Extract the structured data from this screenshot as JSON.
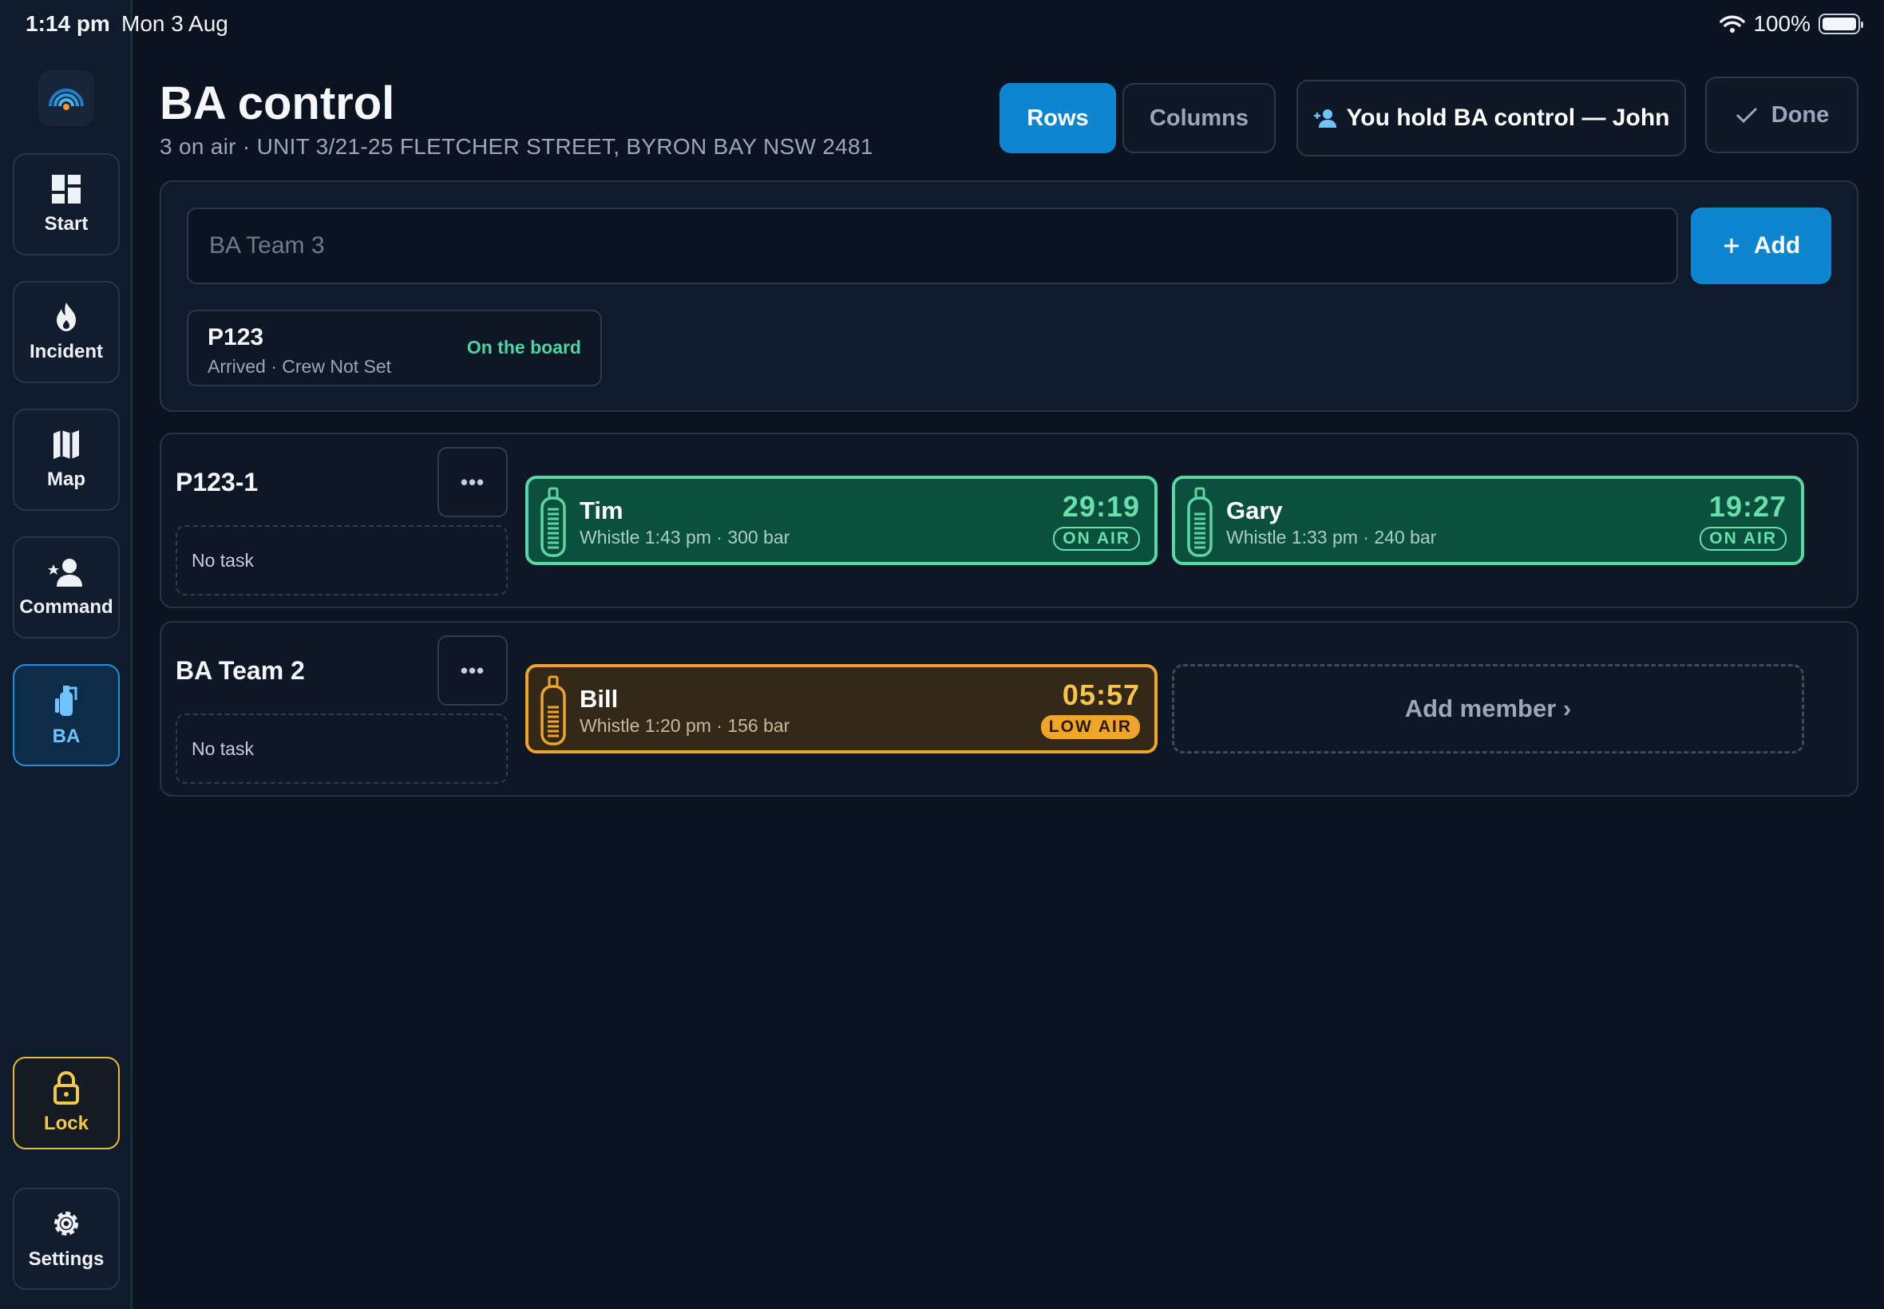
{
  "status_bar": {
    "time": "1:14 pm",
    "date": "Mon 3 Aug",
    "battery": "100%",
    "battery_level": 1.0
  },
  "sidebar": {
    "items": [
      {
        "label": "Start",
        "icon": "dashboard-icon"
      },
      {
        "label": "Incident",
        "icon": "flame-icon"
      },
      {
        "label": "Map",
        "icon": "map-icon"
      },
      {
        "label": "Command",
        "icon": "commander-icon"
      },
      {
        "label": "BA",
        "icon": "ba-cylinder-icon",
        "active": true
      }
    ],
    "lock": {
      "label": "Lock",
      "icon": "lock-icon"
    },
    "settings": {
      "label": "Settings",
      "icon": "gear-icon"
    }
  },
  "header": {
    "title": "BA control",
    "subtitle": "3 on air · UNIT 3/21-25 FLETCHER STREET, BYRON BAY NSW 2481",
    "view_rows": "Rows",
    "view_columns": "Columns",
    "selected_view": "Rows",
    "control_holder": "You hold BA control — John",
    "done": "Done"
  },
  "add_team": {
    "placeholder": "BA Team 3",
    "value": "",
    "add_label": "Add",
    "appliance": {
      "code": "P123",
      "meta": "Arrived · Crew Not Set",
      "state": "On the board"
    }
  },
  "teams": [
    {
      "name": "P123-1",
      "task": "No task",
      "members": [
        {
          "name": "Tim",
          "meta": "Whistle 1:43 pm · 300 bar",
          "timer": "29:19",
          "status": "ON AIR"
        },
        {
          "name": "Gary",
          "meta": "Whistle 1:33 pm · 240 bar",
          "timer": "19:27",
          "status": "ON AIR"
        }
      ]
    },
    {
      "name": "BA Team 2",
      "task": "No task",
      "members": [
        {
          "name": "Bill",
          "meta": "Whistle 1:20 pm · 156 bar",
          "timer": "05:57",
          "status": "LOW AIR"
        }
      ],
      "add_member": "Add member ›"
    }
  ],
  "colors": {
    "accent": "#0e86cf",
    "on_air": "#5cd6a4",
    "low_air": "#f0a42a",
    "lock": "#e9b93b",
    "background": "#0b1320"
  }
}
